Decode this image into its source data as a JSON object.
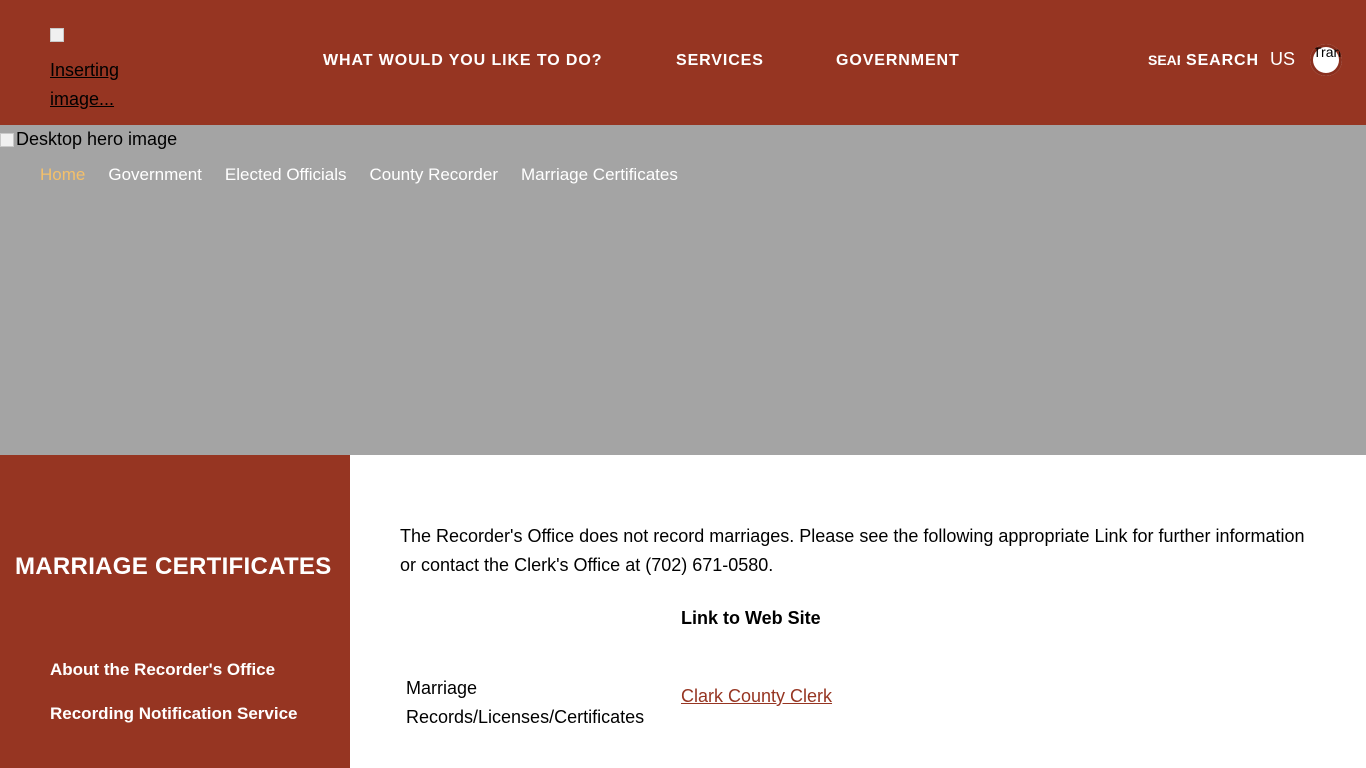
{
  "header": {
    "logo_alt": "Inserting image...",
    "nav": [
      {
        "label": "WHAT WOULD YOU LIKE TO DO?"
      },
      {
        "label": "SERVICES"
      },
      {
        "label": "GOVERNMENT"
      }
    ],
    "search_icon_alt": "SEARCH",
    "search_label": "SEARCH",
    "language": "US",
    "translate_alt": "Translate"
  },
  "hero": {
    "image_alt": "Desktop hero image",
    "breadcrumbs": [
      "Home",
      "Government",
      "Elected Officials",
      "County Recorder",
      "Marriage Certificates"
    ]
  },
  "sidebar": {
    "title": "MARRIAGE CERTIFICATES",
    "links": [
      "About the Recorder's Office",
      "Recording Notification Service"
    ]
  },
  "main": {
    "intro": "The Recorder's Office does not record marriages. Please see the following appropriate Link for further information or contact the Clerk's Office at (702) 671-0580.",
    "table_header": "Link to Web Site",
    "row_label": "Marriage Records/Licenses/Certificates",
    "row_link": "Clark County Clerk"
  },
  "colors": {
    "brand": "#963522",
    "hero_bg": "#a4a4a4",
    "breadcrumb_active": "#f4c06a",
    "link": "#963522"
  }
}
